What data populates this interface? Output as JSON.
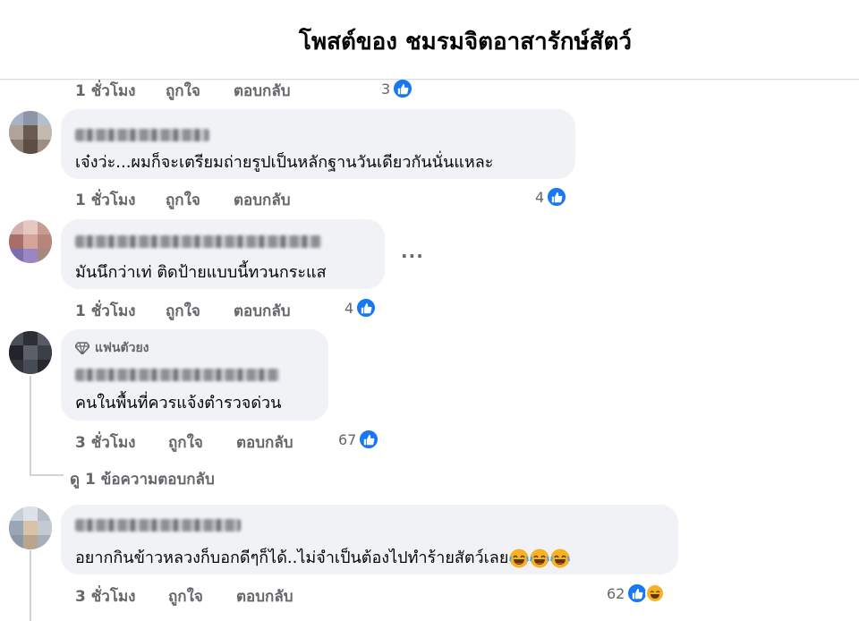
{
  "header": {
    "title": "โพสต์ของ ชมรมจิตอาสารักษ์สัตว์"
  },
  "comments": [
    {
      "time": "1 ชั่วโมง",
      "like": "ถูกใจ",
      "reply": "ตอบกลับ",
      "count": "3"
    },
    {
      "text": "เจ๋งว่ะ...ผมก็จะเตรียมถ่ายรูปเป็นหลักฐานวันเดียวกันนั่นแหละ",
      "time": "1 ชั่วโมง",
      "like": "ถูกใจ",
      "reply": "ตอบกลับ",
      "count": "4"
    },
    {
      "text": "มันนึกว่าเท่ ติดป้ายแบบนี้ทวนกระแส",
      "time": "1 ชั่วโมง",
      "like": "ถูกใจ",
      "reply": "ตอบกลับ",
      "count": "4",
      "more": "···"
    },
    {
      "badge": "แฟนตัวยง",
      "text": "คนในพื้นที่ควรแจ้งตำรวจด่วน",
      "time": "3 ชั่วโมง",
      "like": "ถูกใจ",
      "reply": "ตอบกลับ",
      "count": "67",
      "view_replies": "ดู 1 ข้อความตอบกลับ"
    },
    {
      "text": "อยากกินข้าวหลวงก็บอกดีๆก็ได้..ไม่จำเป็นต้องไปทำร้ายสัตว์เลย",
      "time": "3 ชั่วโมง",
      "like": "ถูกใจ",
      "reply": "ตอบกลับ",
      "count": "62"
    }
  ],
  "icons": {
    "like": "thumbs-up-icon",
    "haha": "laughing-emoji-icon",
    "badge": "diamond-icon"
  },
  "colors": {
    "like_blue": "#1877f2",
    "bubble": "#f0f2f5",
    "meta": "#65676b"
  }
}
